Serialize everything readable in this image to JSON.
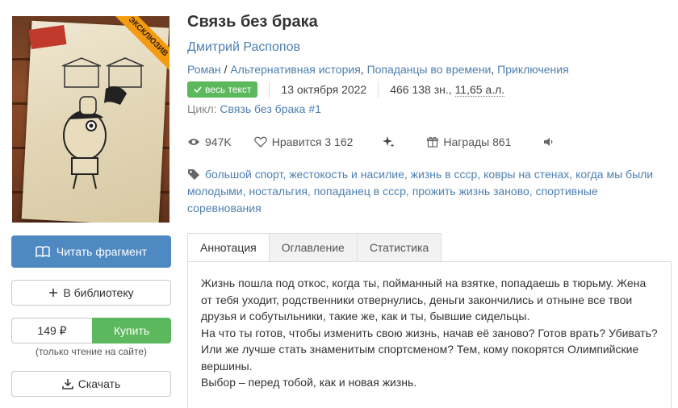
{
  "cover": {
    "ribbon": "ЭКСКЛЮЗИВ"
  },
  "book": {
    "title": "Связь без брака",
    "author": "Дмитрий Распопов",
    "genres": [
      "Роман",
      "Альтернативная история",
      "Попаданцы во времени",
      "Приключения"
    ],
    "badge": "весь текст",
    "date": "13 октября 2022",
    "size_chars": "466 138 зн., ",
    "size_sheets": "11,65 а.л.",
    "cycle_label": "Цикл:",
    "cycle_name": "Связь без брака",
    "cycle_num": "#1"
  },
  "stats": {
    "views": "947K",
    "likes": "Нравится 3 162",
    "awards": "Награды 861"
  },
  "tags": [
    "большой спорт",
    "жестокость и насилие",
    "жизнь в ссср",
    "ковры на стенах",
    "когда мы были молодыми",
    "ностальгия",
    "попаданец в ссср",
    "прожить жизнь заново",
    "спортивные соревнования"
  ],
  "actions": {
    "read": "Читать фрагмент",
    "library": "В библиотеку",
    "price": "149 ₽",
    "buy": "Купить",
    "buy_note": "(только чтение на сайте)",
    "download": "Скачать"
  },
  "tabs": [
    "Аннотация",
    "Оглавление",
    "Статистика"
  ],
  "annotation": [
    "Жизнь пошла под откос, когда ты, пойманный на взятке, попадаешь в тюрьму. Жена от тебя уходит, родственники отвернулись, деньги закончились и отныне все твои друзья и собутыльники, такие же, как и ты, бывшие сидельцы.",
    "На что ты готов, чтобы изменить свою жизнь, начав её заново? Готов врать? Убивать? Или же лучше стать знаменитым спортсменом? Тем, кому покорятся Олимпийские вершины.",
    "Выбор – перед тобой, как и новая жизнь."
  ],
  "colors": {
    "link": "#4e7fb0",
    "primary": "#4e89c1",
    "green": "#5cb85c",
    "ribbon": "#f39c12"
  }
}
